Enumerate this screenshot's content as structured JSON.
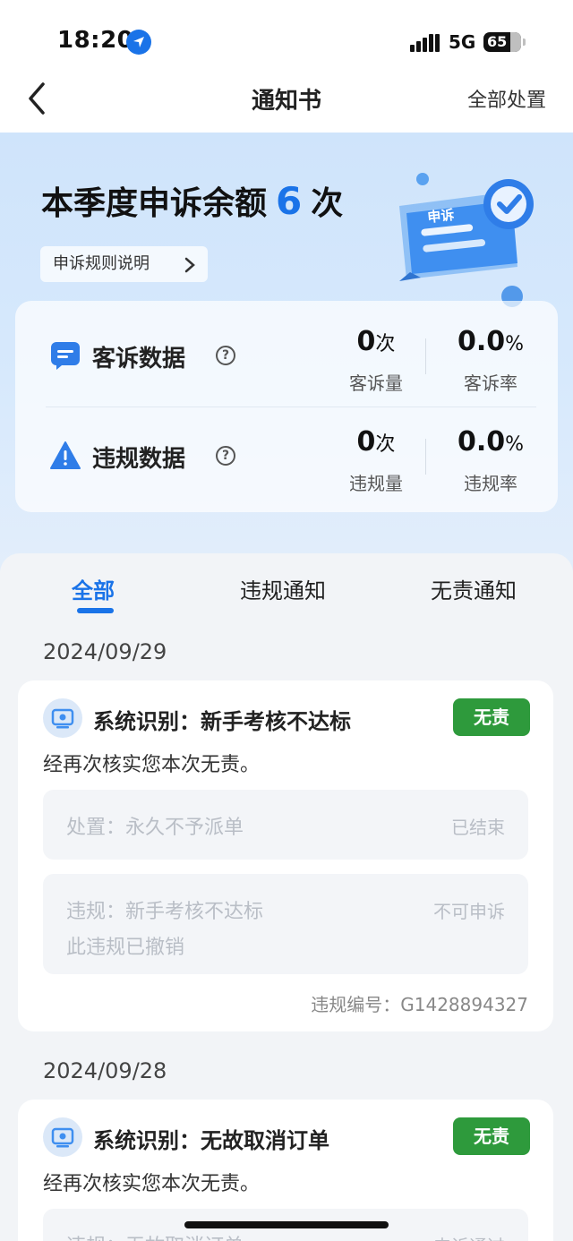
{
  "status_bar": {
    "time": "18:20",
    "network": "5G",
    "battery": "65"
  },
  "nav": {
    "title": "通知书",
    "action": "全部处置"
  },
  "hero": {
    "title_prefix": "本季度申诉余额",
    "count": "6",
    "title_suffix": "次",
    "rule_button": "申诉规则说明",
    "illustration_text": "申诉"
  },
  "stats": {
    "complaint": {
      "label": "客诉数据",
      "volume_value": "0",
      "volume_unit": "次",
      "volume_label": "客诉量",
      "rate_value": "0.0",
      "rate_unit": "%",
      "rate_label": "客诉率"
    },
    "violation": {
      "label": "违规数据",
      "volume_value": "0",
      "volume_unit": "次",
      "volume_label": "违规量",
      "rate_value": "0.0",
      "rate_unit": "%",
      "rate_label": "违规率"
    }
  },
  "tabs": [
    {
      "label": "全部",
      "active": true
    },
    {
      "label": "违规通知",
      "active": false
    },
    {
      "label": "无责通知",
      "active": false
    }
  ],
  "notices": [
    {
      "date": "2024/09/29",
      "title": "系统识别：新手考核不达标",
      "badge": "无责",
      "desc": "经再次核实您本次无责。",
      "disposal_text": "处置：永久不予派单",
      "disposal_status": "已结束",
      "violation_text": "违规：新手考核不达标",
      "violation_note": "此违规已撤销",
      "violation_status": "不可申诉",
      "violation_no": "违规编号：G1428894327"
    },
    {
      "date": "2024/09/28",
      "title": "系统识别：无故取消订单",
      "badge": "无责",
      "desc": "经再次核实您本次无责。",
      "violation_text": "违规：无故取消订单",
      "violation_status": "申诉通过"
    }
  ],
  "colors": {
    "accent": "#1a73e8",
    "success": "#2e9a3c",
    "hero_bg": "#d7e9fc"
  }
}
